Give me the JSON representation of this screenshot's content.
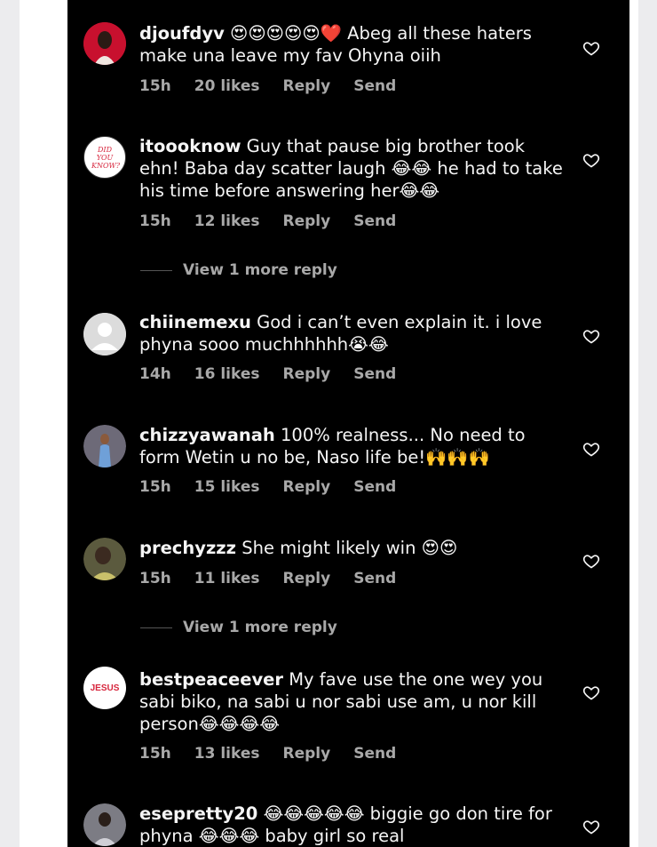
{
  "comments": [
    {
      "username": "djoufdyv",
      "text": "😍😍😍😍😍❤️ Abeg all these haters make una leave my fav Ohyna oiih",
      "time": "15h",
      "likes": "20 likes",
      "reply": "Reply",
      "send": "Send"
    },
    {
      "username": "itoooknow",
      "text": "Guy that pause big brother took ehn! Baba day scatter laugh 😂😂 he had to take his time before answering her😂😂",
      "time": "15h",
      "likes": "12 likes",
      "reply": "Reply",
      "send": "Send",
      "avatar_text": "DID YOU KNOW?"
    },
    {
      "username": "chiinemexu",
      "text": "God i can’t even explain it. i love phyna sooo muchhhhhh😭😂",
      "time": "14h",
      "likes": "16 likes",
      "reply": "Reply",
      "send": "Send"
    },
    {
      "username": "chizzyawanah",
      "text": "100% realness... No need to form Wetin u no be, Naso life be!🙌🙌🙌",
      "time": "15h",
      "likes": "15 likes",
      "reply": "Reply",
      "send": "Send"
    },
    {
      "username": "prechyzzz",
      "text": "She might likely win 😍😍",
      "time": "15h",
      "likes": "11 likes",
      "reply": "Reply",
      "send": "Send"
    },
    {
      "username": "bestpeaceever",
      "text": "My fave use the one wey you sabi biko, na sabi u nor sabi use am, u nor kill person😂😂😂😂",
      "time": "15h",
      "likes": "13 likes",
      "reply": "Reply",
      "send": "Send",
      "avatar_text": "JESUS"
    },
    {
      "username": "esepretty20",
      "text": "😂😂😂😂😂 biggie go don tire for phyna 😂😂😂 baby girl so real"
    }
  ],
  "view_more_1": "View 1 more reply",
  "view_more_2": "View 1 more reply",
  "colors": {
    "background": "#000000",
    "text": "#f5f5f5",
    "meta": "#a8a8a8",
    "jesus_red": "#d7263d"
  },
  "icons": {
    "like": "heart-outline-icon"
  }
}
